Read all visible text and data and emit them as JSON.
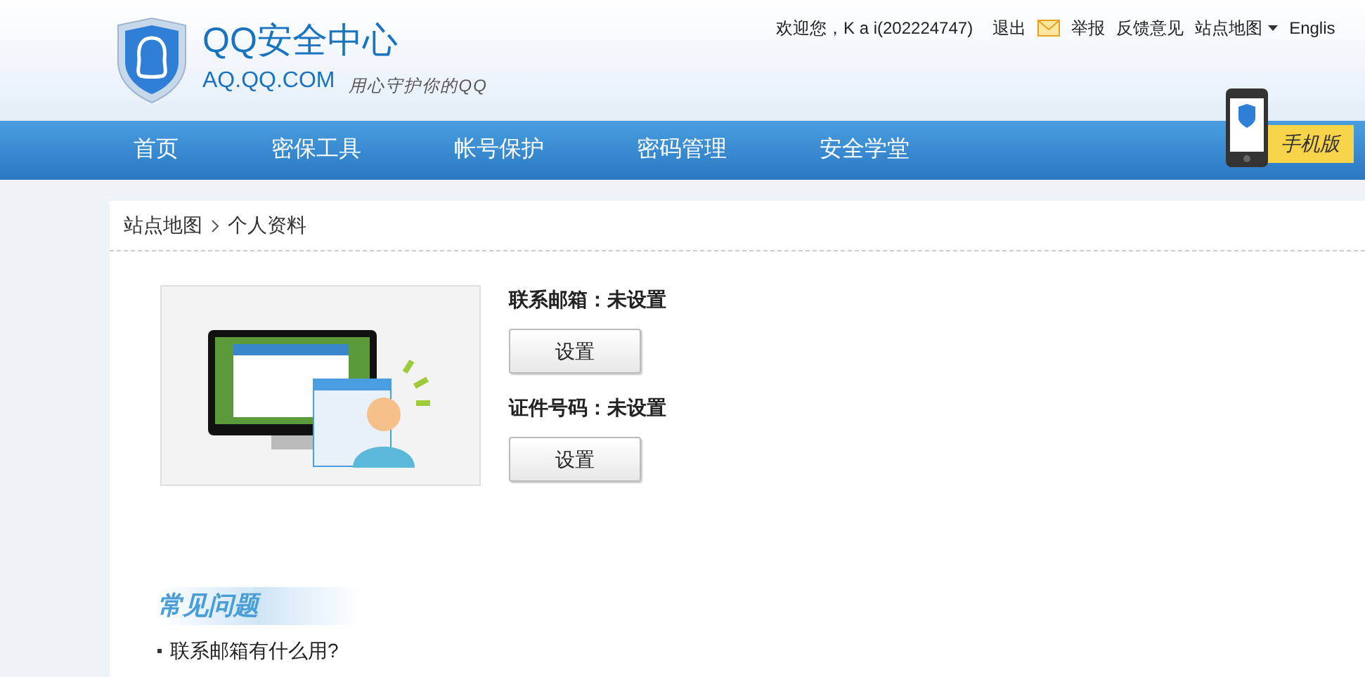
{
  "logo": {
    "title": "QQ安全中心",
    "domain": "AQ.QQ.COM",
    "slogan": "用心守护你的QQ"
  },
  "top_links": [
    {
      "kind": "text",
      "label": "欢迎您，K a i(202224747)"
    },
    {
      "kind": "link",
      "label": "退出"
    },
    {
      "kind": "mail"
    },
    {
      "kind": "link",
      "label": "举报"
    },
    {
      "kind": "link",
      "label": "反馈意见"
    },
    {
      "kind": "dropdown",
      "label": "站点地图"
    },
    {
      "kind": "link",
      "label": "Englis"
    }
  ],
  "nav": [
    {
      "label": "首页"
    },
    {
      "label": "密保工具"
    },
    {
      "label": "帐号保护"
    },
    {
      "label": "密码管理"
    },
    {
      "label": "安全学堂"
    }
  ],
  "mobile_badge": {
    "label": "手机版"
  },
  "breadcrumb": [
    "站点地图",
    "个人资料"
  ],
  "profile": [
    {
      "label": "联系邮箱：未设置",
      "button": "设置"
    },
    {
      "label": "证件号码：未设置",
      "button": "设置"
    }
  ],
  "faq": {
    "title": "常见问题",
    "items": [
      "联系邮箱有什么用?"
    ]
  }
}
